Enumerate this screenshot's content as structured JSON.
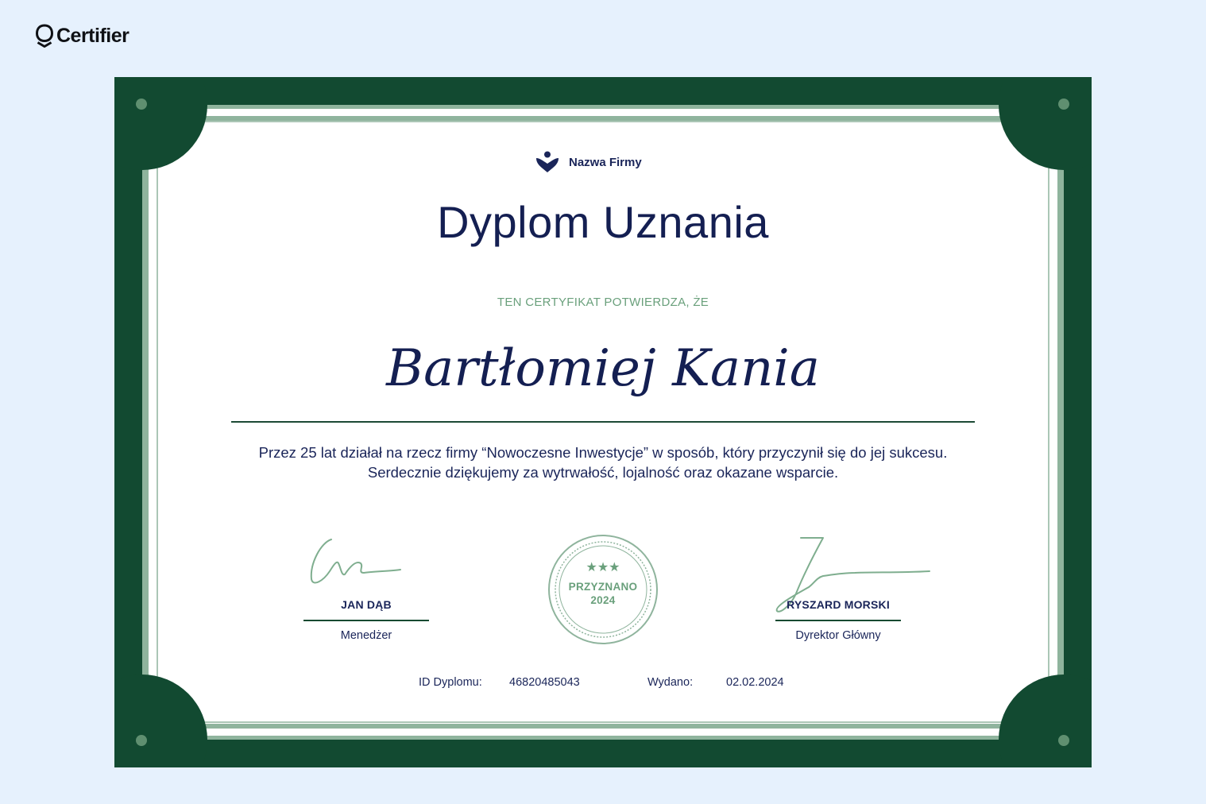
{
  "brand": {
    "name": "Certifier"
  },
  "certificate": {
    "company_name": "Nazwa Firmy",
    "title": "Dyplom Uznania",
    "subtitle": "TEN CERTYFIKAT POTWIERDZA, ŻE",
    "recipient": "Bartłomiej Kania",
    "body": "Przez 25 lat działał na rzecz firmy “Nowoczesne Inwestycje” w sposób, który przyczynił się do jej sukcesu. Serdecznie dziękujemy za wytrwałość, lojalność oraz okazane wsparcie.",
    "signatories": [
      {
        "name": "JAN DĄB",
        "role": "Menedżer"
      },
      {
        "name": "RYSZARD MORSKI",
        "role": "Dyrektor Główny"
      }
    ],
    "seal": {
      "line1": "PRZYZNANO",
      "line2": "2024",
      "stars": "★★★"
    },
    "meta": {
      "id_label": "ID Dyplomu:",
      "id_value": "46820485043",
      "issued_label": "Wydano:",
      "issued_value": "02.02.2024"
    }
  },
  "colors": {
    "background": "#e6f1fd",
    "frame": "#124a31",
    "accent_green": "#6aa07c",
    "navy": "#141f52",
    "paper": "#ffffff"
  }
}
